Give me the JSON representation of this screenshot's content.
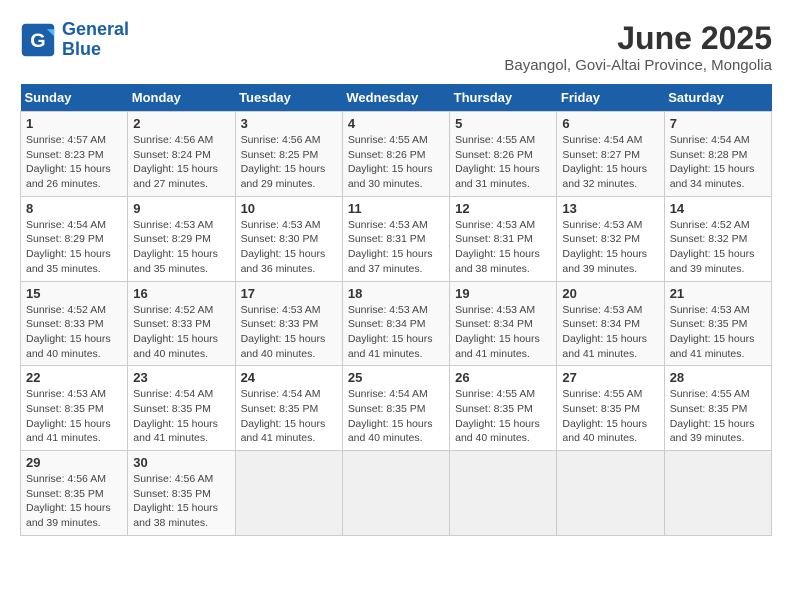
{
  "header": {
    "logo_line1": "General",
    "logo_line2": "Blue",
    "title": "June 2025",
    "subtitle": "Bayangol, Govi-Altai Province, Mongolia"
  },
  "calendar": {
    "days_of_week": [
      "Sunday",
      "Monday",
      "Tuesday",
      "Wednesday",
      "Thursday",
      "Friday",
      "Saturday"
    ],
    "weeks": [
      [
        {
          "day": "",
          "empty": true
        },
        {
          "day": "",
          "empty": true
        },
        {
          "day": "",
          "empty": true
        },
        {
          "day": "",
          "empty": true
        },
        {
          "day": "",
          "empty": true
        },
        {
          "day": "",
          "empty": true
        },
        {
          "day": "",
          "empty": true
        }
      ],
      [
        {
          "day": "1",
          "sunrise": "4:57 AM",
          "sunset": "8:23 PM",
          "daylight": "15 hours and 26 minutes."
        },
        {
          "day": "2",
          "sunrise": "4:56 AM",
          "sunset": "8:24 PM",
          "daylight": "15 hours and 27 minutes."
        },
        {
          "day": "3",
          "sunrise": "4:56 AM",
          "sunset": "8:25 PM",
          "daylight": "15 hours and 29 minutes."
        },
        {
          "day": "4",
          "sunrise": "4:55 AM",
          "sunset": "8:26 PM",
          "daylight": "15 hours and 30 minutes."
        },
        {
          "day": "5",
          "sunrise": "4:55 AM",
          "sunset": "8:26 PM",
          "daylight": "15 hours and 31 minutes."
        },
        {
          "day": "6",
          "sunrise": "4:54 AM",
          "sunset": "8:27 PM",
          "daylight": "15 hours and 32 minutes."
        },
        {
          "day": "7",
          "sunrise": "4:54 AM",
          "sunset": "8:28 PM",
          "daylight": "15 hours and 34 minutes."
        }
      ],
      [
        {
          "day": "8",
          "sunrise": "4:54 AM",
          "sunset": "8:29 PM",
          "daylight": "15 hours and 35 minutes."
        },
        {
          "day": "9",
          "sunrise": "4:53 AM",
          "sunset": "8:29 PM",
          "daylight": "15 hours and 35 minutes."
        },
        {
          "day": "10",
          "sunrise": "4:53 AM",
          "sunset": "8:30 PM",
          "daylight": "15 hours and 36 minutes."
        },
        {
          "day": "11",
          "sunrise": "4:53 AM",
          "sunset": "8:31 PM",
          "daylight": "15 hours and 37 minutes."
        },
        {
          "day": "12",
          "sunrise": "4:53 AM",
          "sunset": "8:31 PM",
          "daylight": "15 hours and 38 minutes."
        },
        {
          "day": "13",
          "sunrise": "4:53 AM",
          "sunset": "8:32 PM",
          "daylight": "15 hours and 39 minutes."
        },
        {
          "day": "14",
          "sunrise": "4:52 AM",
          "sunset": "8:32 PM",
          "daylight": "15 hours and 39 minutes."
        }
      ],
      [
        {
          "day": "15",
          "sunrise": "4:52 AM",
          "sunset": "8:33 PM",
          "daylight": "15 hours and 40 minutes."
        },
        {
          "day": "16",
          "sunrise": "4:52 AM",
          "sunset": "8:33 PM",
          "daylight": "15 hours and 40 minutes."
        },
        {
          "day": "17",
          "sunrise": "4:53 AM",
          "sunset": "8:33 PM",
          "daylight": "15 hours and 40 minutes."
        },
        {
          "day": "18",
          "sunrise": "4:53 AM",
          "sunset": "8:34 PM",
          "daylight": "15 hours and 41 minutes."
        },
        {
          "day": "19",
          "sunrise": "4:53 AM",
          "sunset": "8:34 PM",
          "daylight": "15 hours and 41 minutes."
        },
        {
          "day": "20",
          "sunrise": "4:53 AM",
          "sunset": "8:34 PM",
          "daylight": "15 hours and 41 minutes."
        },
        {
          "day": "21",
          "sunrise": "4:53 AM",
          "sunset": "8:35 PM",
          "daylight": "15 hours and 41 minutes."
        }
      ],
      [
        {
          "day": "22",
          "sunrise": "4:53 AM",
          "sunset": "8:35 PM",
          "daylight": "15 hours and 41 minutes."
        },
        {
          "day": "23",
          "sunrise": "4:54 AM",
          "sunset": "8:35 PM",
          "daylight": "15 hours and 41 minutes."
        },
        {
          "day": "24",
          "sunrise": "4:54 AM",
          "sunset": "8:35 PM",
          "daylight": "15 hours and 41 minutes."
        },
        {
          "day": "25",
          "sunrise": "4:54 AM",
          "sunset": "8:35 PM",
          "daylight": "15 hours and 40 minutes."
        },
        {
          "day": "26",
          "sunrise": "4:55 AM",
          "sunset": "8:35 PM",
          "daylight": "15 hours and 40 minutes."
        },
        {
          "day": "27",
          "sunrise": "4:55 AM",
          "sunset": "8:35 PM",
          "daylight": "15 hours and 40 minutes."
        },
        {
          "day": "28",
          "sunrise": "4:55 AM",
          "sunset": "8:35 PM",
          "daylight": "15 hours and 39 minutes."
        }
      ],
      [
        {
          "day": "29",
          "sunrise": "4:56 AM",
          "sunset": "8:35 PM",
          "daylight": "15 hours and 39 minutes."
        },
        {
          "day": "30",
          "sunrise": "4:56 AM",
          "sunset": "8:35 PM",
          "daylight": "15 hours and 38 minutes."
        },
        {
          "day": "",
          "empty": true
        },
        {
          "day": "",
          "empty": true
        },
        {
          "day": "",
          "empty": true
        },
        {
          "day": "",
          "empty": true
        },
        {
          "day": "",
          "empty": true
        }
      ]
    ]
  }
}
